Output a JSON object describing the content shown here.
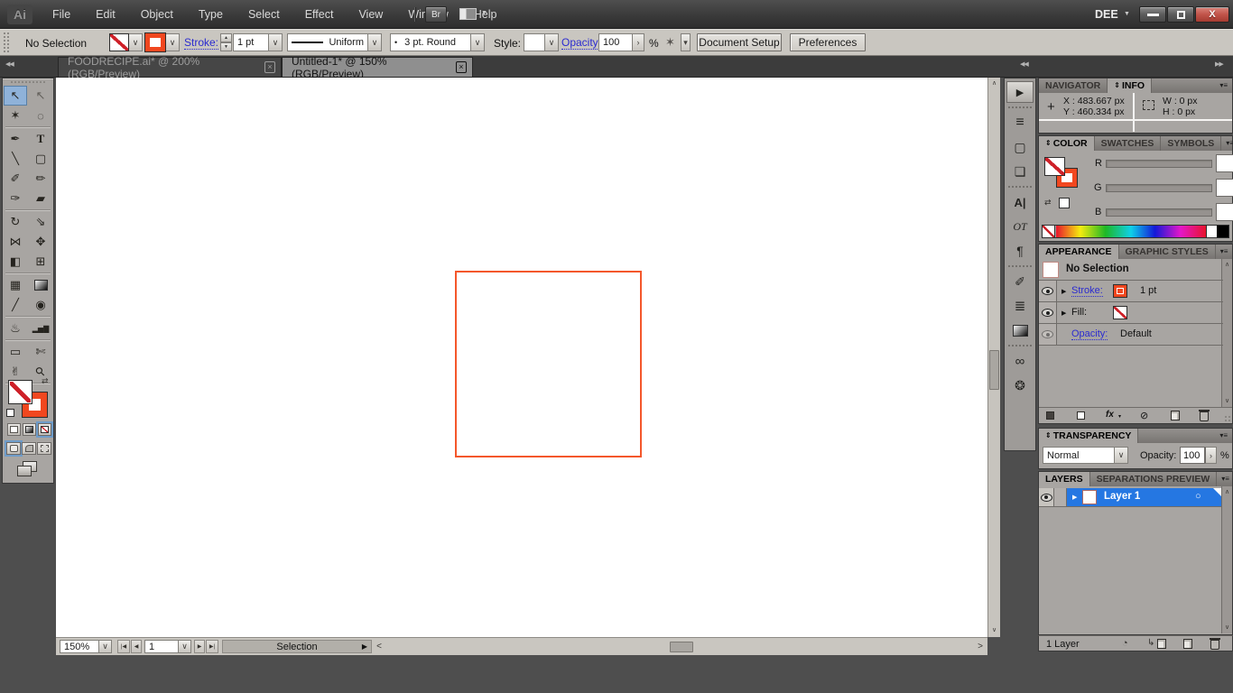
{
  "titlebar": {
    "logo": "Ai",
    "menus": [
      "File",
      "Edit",
      "Object",
      "Type",
      "Select",
      "Effect",
      "View",
      "Window",
      "Help"
    ],
    "bridge": "Br",
    "user": "DEE",
    "close_glyph": "X"
  },
  "control_bar": {
    "selection_status": "No Selection",
    "stroke_label": "Stroke:",
    "stroke_weight": "1 pt",
    "width_profile": "Uniform",
    "brush_name": "3 pt. Round",
    "style_label": "Style:",
    "opacity_label": "Opacity:",
    "opacity_value": "100",
    "percent": "%",
    "document_setup": "Document Setup",
    "preferences": "Preferences"
  },
  "doc_tabs": {
    "tab1": "FOODRECIPE.ai* @ 200% (RGB/Preview)",
    "tab2": "Untitled-1* @ 150% (RGB/Preview)"
  },
  "tools": [
    {
      "name": "selection-tool",
      "glyph": "↖"
    },
    {
      "name": "direct-selection-tool",
      "glyph": "↖"
    },
    {
      "name": "magic-wand-tool",
      "glyph": "✶"
    },
    {
      "name": "lasso-tool",
      "glyph": "◌"
    },
    {
      "name": "pen-tool",
      "glyph": "✒"
    },
    {
      "name": "type-tool",
      "glyph": "T"
    },
    {
      "name": "line-segment-tool",
      "glyph": "╲"
    },
    {
      "name": "rectangle-tool",
      "glyph": "▢"
    },
    {
      "name": "paintbrush-tool",
      "glyph": "✐"
    },
    {
      "name": "pencil-tool",
      "glyph": "✏"
    },
    {
      "name": "blob-brush-tool",
      "glyph": "✑"
    },
    {
      "name": "eraser-tool",
      "glyph": "▰"
    },
    {
      "name": "rotate-tool",
      "glyph": "↻"
    },
    {
      "name": "scale-tool",
      "glyph": "⇘"
    },
    {
      "name": "width-tool",
      "glyph": "⋈"
    },
    {
      "name": "free-transform-tool",
      "glyph": "✥"
    },
    {
      "name": "shape-builder-tool",
      "glyph": "◧"
    },
    {
      "name": "perspective-grid-tool",
      "glyph": "⊞"
    },
    {
      "name": "mesh-tool",
      "glyph": "▦"
    },
    {
      "name": "gradient-tool",
      "glyph": ""
    },
    {
      "name": "eyedropper-tool",
      "glyph": "╱"
    },
    {
      "name": "blend-tool",
      "glyph": "◉"
    },
    {
      "name": "symbol-sprayer-tool",
      "glyph": "♨"
    },
    {
      "name": "column-graph-tool",
      "glyph": "▂▅▇"
    },
    {
      "name": "artboard-tool",
      "glyph": "▭"
    },
    {
      "name": "slice-tool",
      "glyph": "✄"
    },
    {
      "name": "hand-tool",
      "glyph": "✌"
    },
    {
      "name": "zoom-tool",
      "glyph": "⚲"
    }
  ],
  "dock_icons": [
    {
      "name": "actions-panel-icon",
      "glyph": "▶"
    },
    {
      "name": "align-panel-icon",
      "glyph": "≡"
    },
    {
      "name": "transform-panel-icon",
      "glyph": "▢"
    },
    {
      "name": "pathfinder-panel-icon",
      "glyph": "❏"
    },
    {
      "name": "character-panel-icon",
      "glyph": "A|"
    },
    {
      "name": "opentype-panel-icon",
      "glyph": "OT"
    },
    {
      "name": "paragraph-panel-icon",
      "glyph": "¶"
    },
    {
      "name": "brushes-panel-icon",
      "glyph": "✐"
    },
    {
      "name": "stroke-panel-icon",
      "glyph": "≣"
    },
    {
      "name": "gradient-panel-icon",
      "glyph": ""
    },
    {
      "name": "links-panel-icon",
      "glyph": "∞"
    },
    {
      "name": "symbols-panel-icon",
      "glyph": "❂"
    }
  ],
  "panels": {
    "info": {
      "tab_navigator": "NAVIGATOR",
      "tab_info": "INFO",
      "x": "X : 483.667 px",
      "y": "Y : 460.334 px",
      "w": "W : 0 px",
      "h": "H : 0 px"
    },
    "color": {
      "tab_color": "COLOR",
      "tab_swatches": "SWATCHES",
      "tab_symbols": "SYMBOLS",
      "r": "R",
      "g": "G",
      "b": "B"
    },
    "appearance": {
      "tab_appearance": "APPEARANCE",
      "tab_graphic_styles": "GRAPHIC STYLES",
      "no_selection": "No Selection",
      "stroke_label": "Stroke:",
      "stroke_value": "1 pt",
      "fill_label": "Fill:",
      "opacity_label": "Opacity:",
      "opacity_value": "Default",
      "fx": "fx"
    },
    "transparency": {
      "tab": "TRANSPARENCY",
      "mode": "Normal",
      "opacity_label": "Opacity:",
      "opacity_value": "100",
      "percent": "%"
    },
    "layers": {
      "tab_layers": "LAYERS",
      "tab_separations": "SEPARATIONS PREVIEW",
      "layer_name": "Layer 1",
      "count": "1 Layer"
    }
  },
  "status_bar": {
    "zoom": "150%",
    "artboard": "1",
    "status": "Selection"
  },
  "icons": {
    "chevron": "∨",
    "up_arrow": "∧",
    "down_arrow": "∨",
    "left_arrow": "<",
    "right_arrow": ">",
    "panel_menu": "▾≡",
    "collapse_left": "◀◀",
    "collapse_right": "▶▶",
    "spin_up": "▲",
    "spin_down": "▼",
    "menu_arrow": "▼",
    "close_tab": "×",
    "updown": "⇕",
    "swap_arrows": "⇄",
    "expand_arrow": "▶",
    "crosshair": "+",
    "bullet": "•",
    "nav_first": "|◀",
    "nav_prev": "◀",
    "nav_next": "▶",
    "nav_last": "▶|",
    "status_arrow": "▶",
    "clear": "⊘",
    "target": "○",
    "clip_mask": "◔",
    "sublayer_arrow": "↳",
    "fx_arrow": "▾",
    "more": "›",
    "select_similar": "✶"
  }
}
